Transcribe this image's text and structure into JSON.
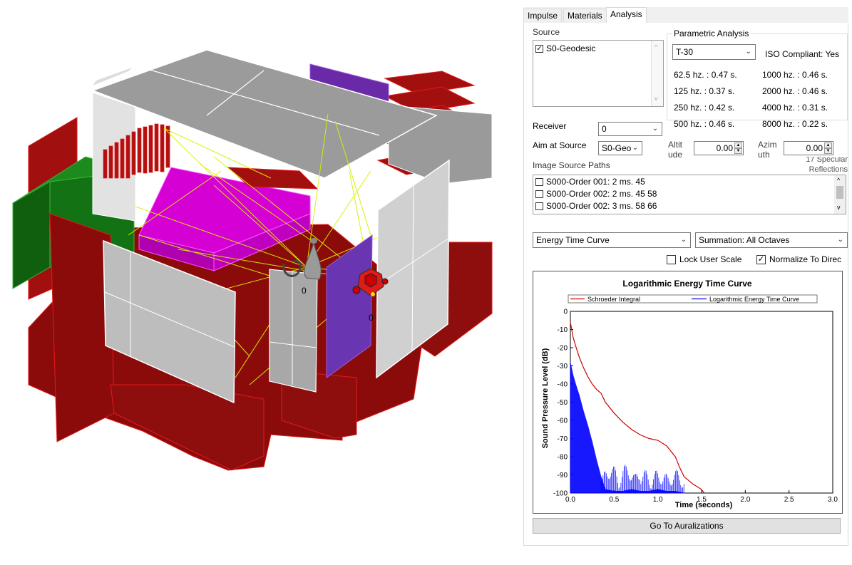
{
  "tabs": [
    "Impulse",
    "Materials",
    "Analysis"
  ],
  "source": {
    "label": "Source",
    "items": [
      {
        "name": "S0-Geodesic",
        "checked": true
      }
    ]
  },
  "parametric": {
    "label": "Parametric Analysis",
    "selected": "T-30",
    "iso": "ISO Compliant: Yes",
    "results": [
      "62.5 hz. : 0.47 s.",
      "1000 hz. : 0.46 s.",
      "125 hz. : 0.37 s.",
      "2000 hz. : 0.46 s.",
      "250 hz. : 0.42 s.",
      "4000 hz. : 0.31 s.",
      "500 hz. : 0.46 s.",
      "8000 hz. : 0.22 s."
    ]
  },
  "receiver": {
    "label": "Receiver",
    "value": "0"
  },
  "aim": {
    "label": "Aim at Source",
    "value": "S0-Geo",
    "altitude_label_1": "Altit",
    "altitude_label_2": "ude",
    "altitude_value": "0.00",
    "azimuth_label_1": "Azim",
    "azimuth_label_2": "uth",
    "azimuth_value": "0.00"
  },
  "specular": {
    "line1": "17 Specular",
    "line2": "Reflections"
  },
  "image_source": {
    "label": "Image Source Paths",
    "paths": [
      "S000-Order 001: 2 ms. 45",
      "S000-Order 002: 2 ms. 45 58",
      "S000-Order 002: 3 ms. 58 66"
    ]
  },
  "display": {
    "curve_type": "Energy Time Curve",
    "summation": "Summation: All Octaves",
    "lock_label": "Lock User Scale",
    "normalize_label": "Normalize  To Direc",
    "lock_checked": false,
    "normalize_checked": true
  },
  "button": {
    "go": "Go To Auralizations"
  },
  "viewport_labels": {
    "receiver_id": "0",
    "source_id": "0"
  },
  "colors": {
    "schroeder": "#cc0000",
    "etc": "#0000ff",
    "rays": "#d8f000",
    "walls": "#8b0b0b",
    "accent": "#cc00cc"
  },
  "chart_data": {
    "type": "line",
    "title": "Logarithmic Energy Time Curve",
    "xlabel": "Time (seconds)",
    "ylabel": "Sound Pressure Level (dB)",
    "xlim": [
      0,
      3.0
    ],
    "ylim": [
      -100,
      0
    ],
    "x_ticks": [
      "0.0",
      "0.5",
      "1.0",
      "1.5",
      "2.0",
      "2.5",
      "3.0"
    ],
    "y_ticks": [
      "0",
      "-10",
      "-20",
      "-30",
      "-40",
      "-50",
      "-60",
      "-70",
      "-80",
      "-90",
      "-100"
    ],
    "legend": "top",
    "series": [
      {
        "name": "Schroeder Integral",
        "color": "#cc0000",
        "x": [
          0.0,
          0.03,
          0.06,
          0.1,
          0.15,
          0.2,
          0.25,
          0.3,
          0.35,
          0.4,
          0.5,
          0.6,
          0.7,
          0.8,
          0.9,
          1.0,
          1.1,
          1.2,
          1.25,
          1.3,
          1.4,
          1.5,
          1.53
        ],
        "y": [
          -6,
          -14,
          -19,
          -25,
          -31,
          -36,
          -40,
          -43,
          -45,
          -50,
          -56,
          -61,
          -65,
          -68,
          -70,
          -71,
          -74,
          -80,
          -86,
          -91,
          -95,
          -98,
          -100
        ]
      },
      {
        "name": "Logarithmic Energy Time Curve",
        "color": "#0000ff",
        "x": [
          0.0,
          0.03,
          0.06,
          0.1,
          0.15,
          0.2,
          0.25,
          0.3,
          0.35,
          0.4,
          0.5,
          0.6,
          0.7,
          0.8,
          0.9,
          1.0,
          1.1,
          1.2,
          1.3
        ],
        "y": [
          -28,
          -35,
          -40,
          -46,
          -55,
          -63,
          -72,
          -82,
          -91,
          -98,
          -99,
          -99,
          -98,
          -99,
          -99,
          -98,
          -99,
          -99,
          -100
        ]
      }
    ]
  }
}
